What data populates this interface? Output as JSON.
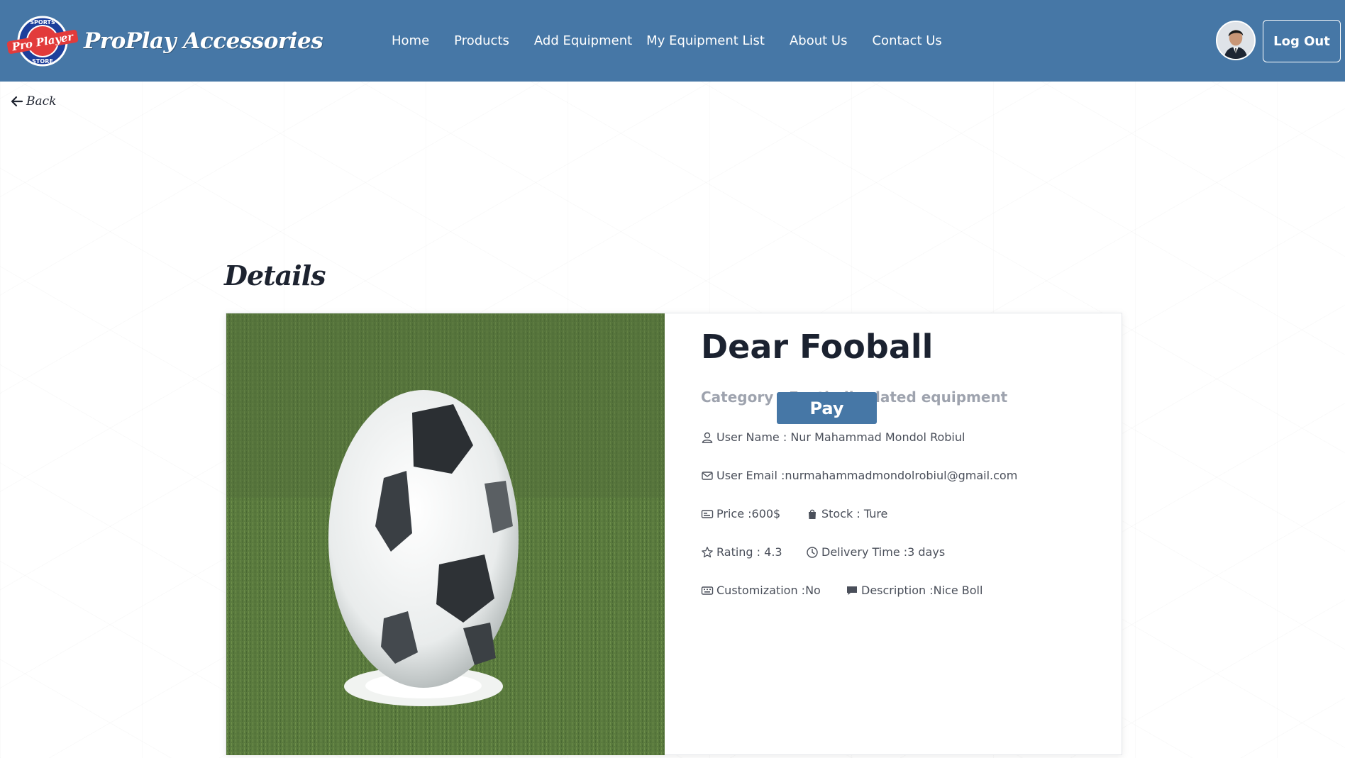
{
  "navbar": {
    "brand_name": "ProPlay Accessories",
    "logo_texts": {
      "top": "SPORTS",
      "middle": "Pro Player",
      "bottom": "STORE"
    },
    "links": [
      "Home",
      "Products",
      "Add Equipment",
      "My Equipment List",
      "About Us",
      "Contact Us"
    ],
    "logout_label": "Log Out",
    "background_color": "#4677a6"
  },
  "back": {
    "label": "Back",
    "icon": "arrow-left-icon"
  },
  "page": {
    "heading": "Details"
  },
  "product": {
    "name": "Dear Fooball",
    "category": "Category : Football related equipment",
    "user_name": "User Name : Nur Mahammad Mondol Robiul",
    "user_email": "User Email :nurmahammadmondolrobiul@gmail.com",
    "price": "Price :600$",
    "stock": "Stock : Ture",
    "rating": "Rating : 4.3",
    "delivery_time": "Delivery Time :3 days",
    "customization": "Customization :No",
    "description": "Description :Nice Boll",
    "image_alt": "Football on grass",
    "icons": {
      "user": "user-icon",
      "email": "envelope-icon",
      "price": "price-tag-icon",
      "stock": "shopping-bag-icon",
      "rating": "star-icon",
      "delivery": "clock-icon",
      "customization": "keyboard-icon",
      "description": "comment-icon"
    }
  },
  "actions": {
    "pay_label": "Pay",
    "accent_color": "#4677a6"
  }
}
